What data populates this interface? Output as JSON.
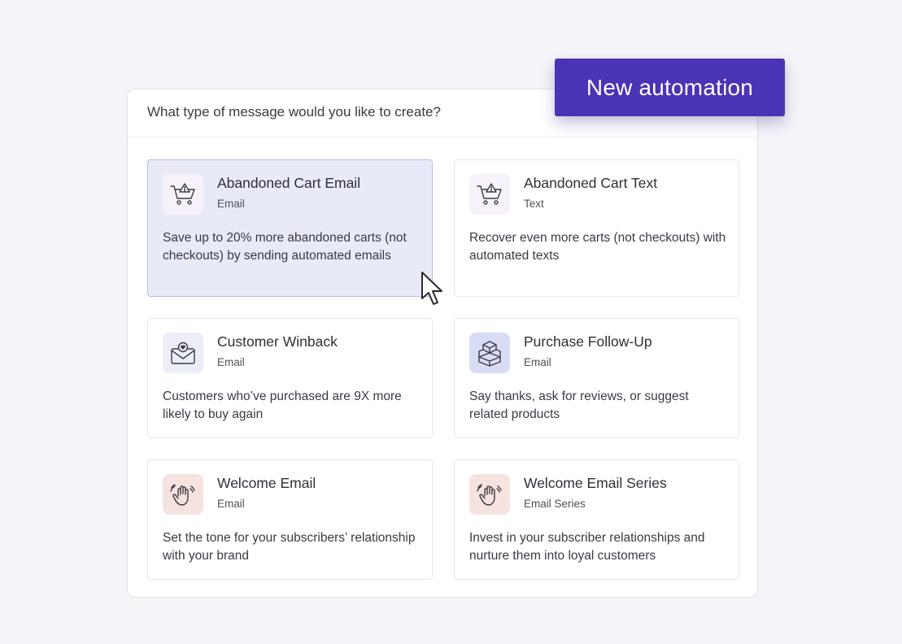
{
  "header": {
    "question": "What type of message would you like to create?"
  },
  "cta": {
    "label": "New automation"
  },
  "colors": {
    "accent": "#4b33b5",
    "selected_bg": "#e9eaf7",
    "icon_cart": "#f7f2fa",
    "icon_envelope": "#eceef7",
    "icon_box": "#d9dcf5",
    "icon_wave": "#f6e3df"
  },
  "cards": [
    {
      "title": "Abandoned Cart Email",
      "type": "Email",
      "description": "Save up to 20% more abandoned carts (not checkouts) by sending automated emails",
      "icon": "shopping-cart-warning-icon",
      "selected": true
    },
    {
      "title": "Abandoned Cart Text",
      "type": "Text",
      "description": "Recover even more carts (not checkouts) with automated texts",
      "icon": "shopping-cart-warning-icon",
      "selected": false
    },
    {
      "title": "Customer Winback",
      "type": "Email",
      "description": "Customers who’ve purchased are 9X more likely to buy again",
      "icon": "envelope-heart-icon",
      "selected": false
    },
    {
      "title": "Purchase Follow-Up",
      "type": "Email",
      "description": "Say thanks, ask for reviews, or suggest related products",
      "icon": "stacked-boxes-icon",
      "selected": false
    },
    {
      "title": "Welcome Email",
      "type": "Email",
      "description": "Set the tone for your subscribers’ relationship with your brand",
      "icon": "waving-hand-icon",
      "selected": false
    },
    {
      "title": "Welcome Email Series",
      "type": "Email Series",
      "description": "Invest in your subscriber relationships and nurture them into loyal customers",
      "icon": "waving-hand-icon",
      "selected": false
    }
  ]
}
